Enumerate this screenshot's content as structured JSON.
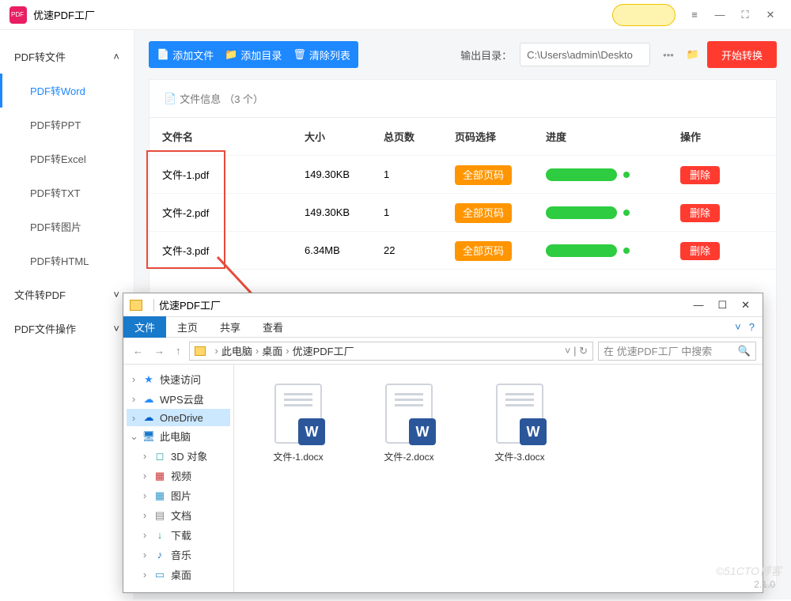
{
  "app": {
    "title": "优速PDF工厂",
    "version": "2.1.0",
    "watermark": "©51CTO博客"
  },
  "titlebar_icons": {
    "menu": "≡",
    "min": "—",
    "max": "⛶",
    "close": "✕"
  },
  "sidebar": {
    "groups": [
      {
        "label": "PDF转文件",
        "open": true
      },
      {
        "label": "文件转PDF",
        "open": false
      },
      {
        "label": "PDF文件操作",
        "open": false
      }
    ],
    "items": [
      {
        "label": "PDF转Word",
        "active": true
      },
      {
        "label": "PDF转PPT"
      },
      {
        "label": "PDF转Excel"
      },
      {
        "label": "PDF转TXT"
      },
      {
        "label": "PDF转图片"
      },
      {
        "label": "PDF转HTML"
      }
    ]
  },
  "toolbar": {
    "add_file": "添加文件",
    "add_dir": "添加目录",
    "clear": "清除列表",
    "output_label": "输出目录：",
    "output_path": "C:\\Users\\admin\\Deskto",
    "dots": "•••",
    "start": "开始转换"
  },
  "panel": {
    "info_label": "文件信息",
    "count_label": "（3 个）",
    "columns": {
      "name": "文件名",
      "size": "大小",
      "pages": "总页数",
      "range": "页码选择",
      "progress": "进度",
      "action": "操作"
    },
    "rows": [
      {
        "name": "文件-1.pdf",
        "size": "149.30KB",
        "pages": "1",
        "range": "全部页码",
        "action": "删除"
      },
      {
        "name": "文件-2.pdf",
        "size": "149.30KB",
        "pages": "1",
        "range": "全部页码",
        "action": "删除"
      },
      {
        "name": "文件-3.pdf",
        "size": "6.34MB",
        "pages": "22",
        "range": "全部页码",
        "action": "删除"
      }
    ]
  },
  "explorer": {
    "title": "优速PDF工厂",
    "ribbon": {
      "file": "文件",
      "home": "主页",
      "share": "共享",
      "view": "查看"
    },
    "breadcrumb": [
      "此电脑",
      "桌面",
      "优速PDF工厂"
    ],
    "search_placeholder": "在 优速PDF工厂 中搜索",
    "nav": [
      {
        "label": "快速访问",
        "icon": "star",
        "tw": "›"
      },
      {
        "label": "WPS云盘",
        "icon": "cloud",
        "tw": "›"
      },
      {
        "label": "OneDrive",
        "icon": "cloud2",
        "tw": "›",
        "sel": true
      },
      {
        "label": "此电脑",
        "icon": "pc",
        "tw": "⌄"
      },
      {
        "label": "3D 对象",
        "icon": "3d",
        "tw": "›",
        "indent": true
      },
      {
        "label": "视频",
        "icon": "video",
        "tw": "›",
        "indent": true
      },
      {
        "label": "图片",
        "icon": "image",
        "tw": "›",
        "indent": true
      },
      {
        "label": "文档",
        "icon": "doc",
        "tw": "›",
        "indent": true
      },
      {
        "label": "下载",
        "icon": "dl",
        "tw": "›",
        "indent": true
      },
      {
        "label": "音乐",
        "icon": "music",
        "tw": "›",
        "indent": true
      },
      {
        "label": "桌面",
        "icon": "desk",
        "tw": "›",
        "indent": true
      }
    ],
    "files": [
      {
        "name": "文件-1.docx"
      },
      {
        "name": "文件-2.docx"
      },
      {
        "name": "文件-3.docx"
      }
    ]
  }
}
